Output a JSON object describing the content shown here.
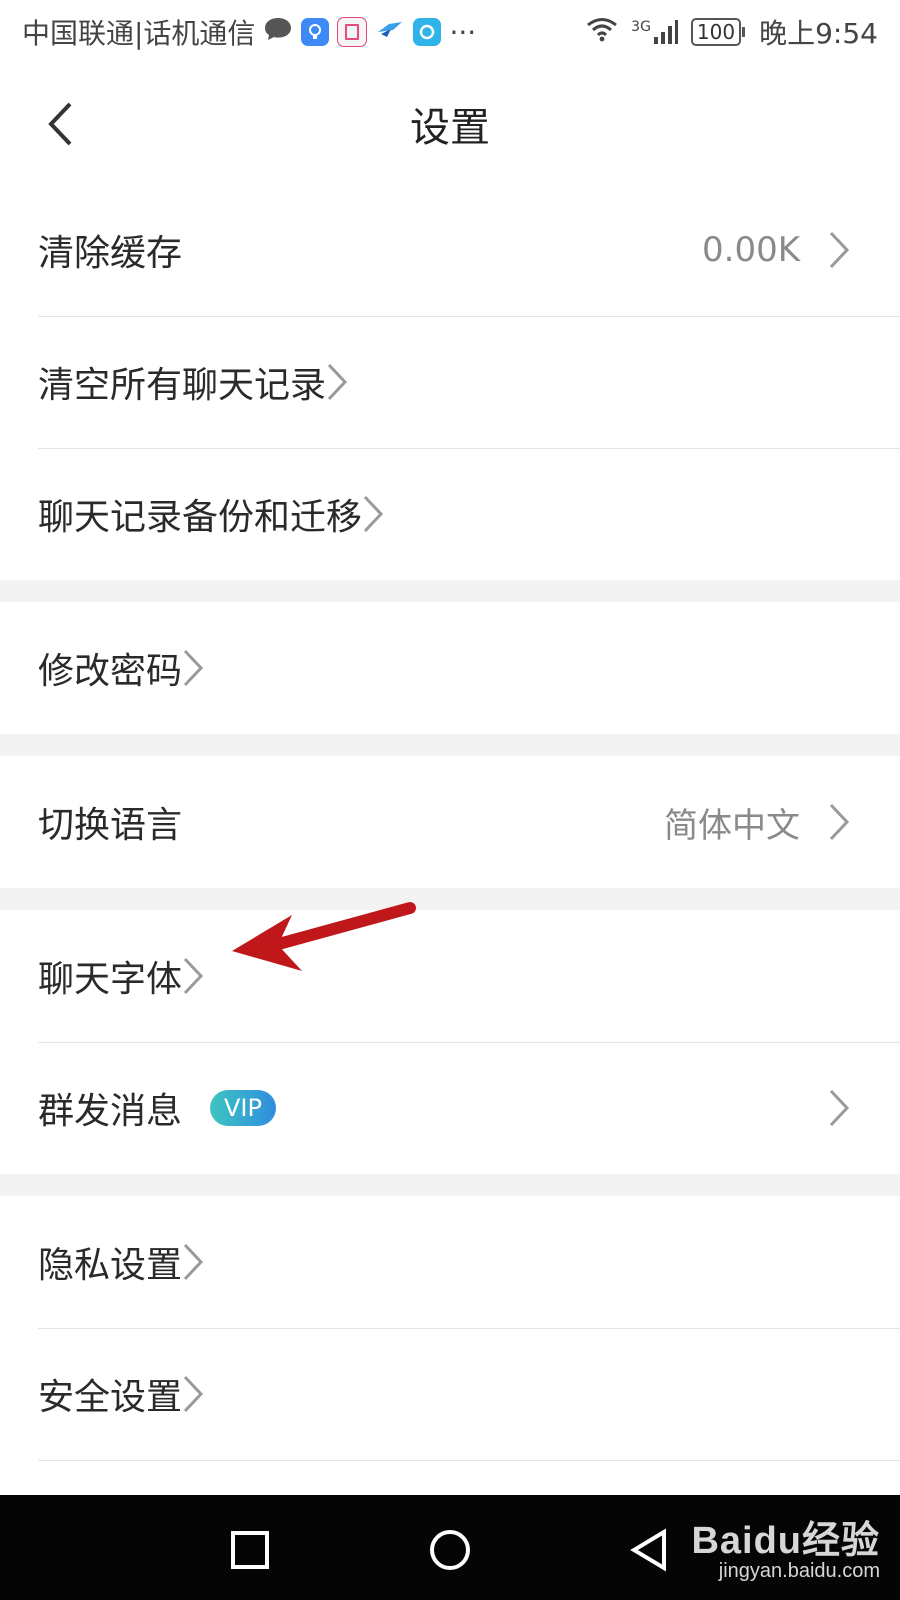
{
  "status_bar": {
    "carrier": "中国联通|话机通信",
    "more": "···",
    "network": "3G",
    "battery": "100",
    "time": "晚上9:54"
  },
  "header": {
    "title": "设置"
  },
  "settings": [
    {
      "items": [
        {
          "label": "清除缓存",
          "value": "0.00K"
        },
        {
          "label": "清空所有聊天记录"
        },
        {
          "label": "聊天记录备份和迁移"
        }
      ]
    },
    {
      "items": [
        {
          "label": "修改密码"
        }
      ]
    },
    {
      "items": [
        {
          "label": "切换语言",
          "value": "简体中文"
        }
      ]
    },
    {
      "items": [
        {
          "label": "聊天字体"
        },
        {
          "label": "群发消息",
          "badge": "VIP"
        }
      ]
    },
    {
      "items": [
        {
          "label": "隐私设置"
        },
        {
          "label": "安全设置"
        }
      ]
    }
  ],
  "watermark": {
    "brand": "Baidu经验",
    "url": "jingyan.baidu.com"
  },
  "colors": {
    "annotation_arrow": "#c0171b",
    "vip_start": "#3ec5c2",
    "vip_end": "#2f8ddf",
    "section_gap": "#f3f3f3"
  }
}
